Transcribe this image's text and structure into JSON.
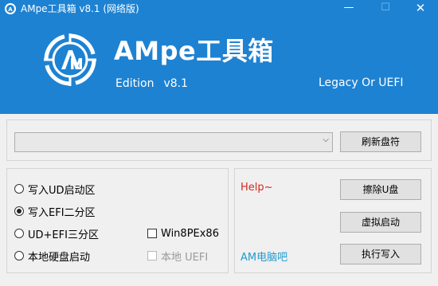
{
  "window": {
    "title": "AMpe工具箱 v8.1 (网络版)",
    "minimize_glyph": "—",
    "maximize_glyph": "☐",
    "close_glyph": "✕",
    "icon": "app-logo-icon"
  },
  "banner": {
    "brand": "AMpe工具箱",
    "edition_label": "Edition",
    "version": "v8.1",
    "mode": "Legacy Or UEFI",
    "background_color": "#1e82d2"
  },
  "disk": {
    "selected_value": "",
    "refresh_button": "刷新盘符"
  },
  "options": {
    "radios": [
      {
        "label": "写入UD启动区",
        "checked": false
      },
      {
        "label": "写入EFI二分区",
        "checked": true
      },
      {
        "label": "UD+EFI三分区",
        "checked": false
      },
      {
        "label": "本地硬盘启动",
        "checked": false
      }
    ],
    "checkboxes": [
      {
        "label": "Win8PEx86",
        "checked": false,
        "enabled": true
      },
      {
        "label": "本地 UEFI",
        "checked": false,
        "enabled": false
      }
    ]
  },
  "actions": {
    "help_link": "Help~",
    "site_link": "AM电脑吧",
    "erase_button": "擦除U盘",
    "virtual_boot_button": "虚拟启动",
    "execute_button": "执行写入"
  }
}
